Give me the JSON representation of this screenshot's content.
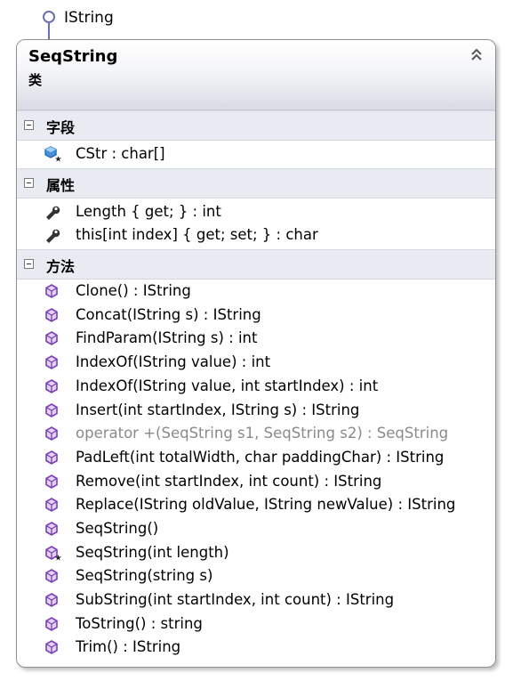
{
  "interface": {
    "name": "IString"
  },
  "class": {
    "name": "SeqString",
    "stereotype": "类"
  },
  "sections": {
    "fields": {
      "title": "字段",
      "items": [
        {
          "text": "CStr : char[]",
          "icon": "field-icon"
        }
      ]
    },
    "properties": {
      "title": "属性",
      "items": [
        {
          "text": "Length { get; } : int",
          "icon": "wrench-icon"
        },
        {
          "text": "this[int index] { get; set; } : char",
          "icon": "wrench-icon"
        }
      ]
    },
    "methods": {
      "title": "方法",
      "items": [
        {
          "text": "Clone() : IString",
          "icon": "method-icon"
        },
        {
          "text": "Concat(IString s) : IString",
          "icon": "method-icon"
        },
        {
          "text": "FindParam(IString s) : int",
          "icon": "method-icon"
        },
        {
          "text": "IndexOf(IString value) : int",
          "icon": "method-icon"
        },
        {
          "text": "IndexOf(IString value, int startIndex) : int",
          "icon": "method-icon"
        },
        {
          "text": "Insert(int startIndex, IString s) : IString",
          "icon": "method-icon"
        },
        {
          "text": "operator +(SeqString s1, SeqString s2) : SeqString",
          "icon": "method-icon",
          "disabled": true
        },
        {
          "text": "PadLeft(int totalWidth, char paddingChar) : IString",
          "icon": "method-icon"
        },
        {
          "text": "Remove(int startIndex, int count) : IString",
          "icon": "method-icon"
        },
        {
          "text": "Replace(IString oldValue, IString newValue) : IString",
          "icon": "method-icon"
        },
        {
          "text": "SeqString()",
          "icon": "method-icon"
        },
        {
          "text": "SeqString(int length)",
          "icon": "method-protected-icon"
        },
        {
          "text": "SeqString(string s)",
          "icon": "method-icon"
        },
        {
          "text": "SubString(int startIndex, int count) : IString",
          "icon": "method-icon"
        },
        {
          "text": "ToString() : string",
          "icon": "method-icon"
        },
        {
          "text": "Trim() : IString",
          "icon": "method-icon"
        }
      ]
    }
  },
  "colors": {
    "method_icon": "#7b3fb4",
    "field_icon": "#1e6fb8",
    "wrench_icon": "#333333",
    "disabled_text": "#8a8a8a"
  }
}
